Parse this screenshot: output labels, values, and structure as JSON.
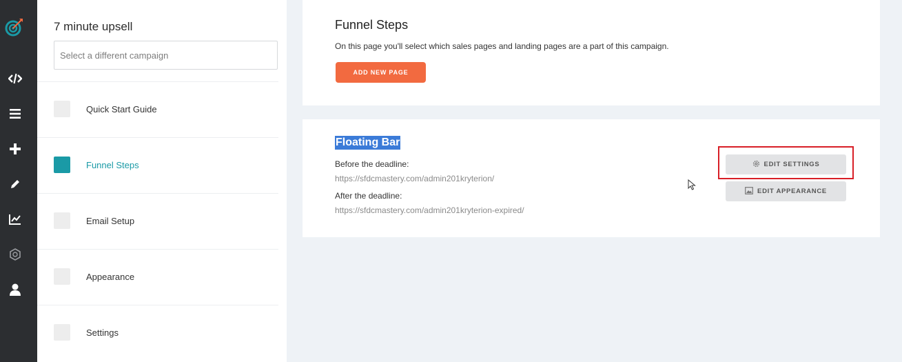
{
  "sidebar": {
    "campaign_title": "7 minute upsell",
    "select_placeholder": "Select a different campaign",
    "items": [
      {
        "label": "Quick Start Guide",
        "active": false
      },
      {
        "label": "Funnel Steps",
        "active": true
      },
      {
        "label": "Email Setup",
        "active": false
      },
      {
        "label": "Appearance",
        "active": false
      },
      {
        "label": "Settings",
        "active": false
      }
    ]
  },
  "rail": {
    "icons": [
      "logo-icon",
      "code-icon",
      "menu-icon",
      "plus-icon",
      "pencil-icon",
      "chart-icon",
      "hexagon-icon",
      "user-icon"
    ]
  },
  "funnel": {
    "title": "Funnel Steps",
    "description": "On this page you'll select which sales pages and landing pages are a part of this campaign.",
    "add_button": "ADD NEW PAGE"
  },
  "step": {
    "title": "Floating Bar",
    "before_label": "Before the deadline:",
    "before_url": "https://sfdcmastery.com/admin201kryterion/",
    "after_label": "After the deadline:",
    "after_url": "https://sfdcmastery.com/admin201kryterion-expired/",
    "edit_settings": "EDIT SETTINGS",
    "edit_appearance": "EDIT APPEARANCE"
  },
  "colors": {
    "accent": "#1a9aa6",
    "primary_button": "#f26a40",
    "highlight": "#d81e26",
    "rail": "#2c2e31"
  }
}
